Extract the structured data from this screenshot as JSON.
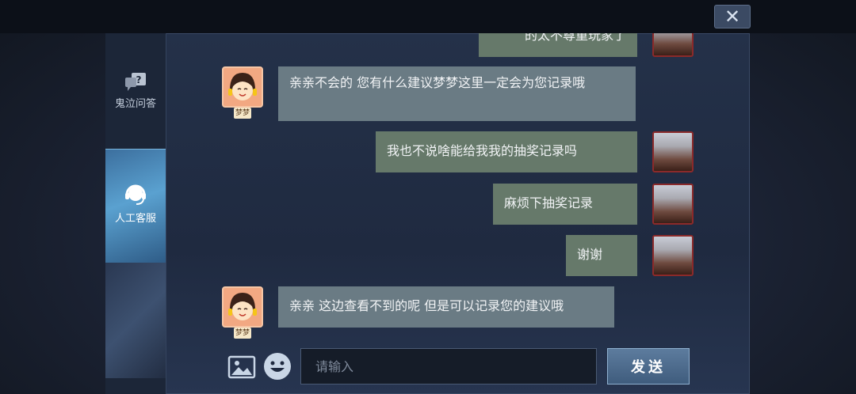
{
  "window": {
    "close_glyph": "✕"
  },
  "sidebar": {
    "items": [
      {
        "label": "鬼泣问答",
        "icon": "question-bubble-icon"
      },
      {
        "label": "人工客服",
        "icon": "headset-icon"
      }
    ]
  },
  "chat": {
    "messages": [
      {
        "from": "user",
        "text": "的太不尊重玩家了"
      },
      {
        "from": "agent",
        "name": "梦梦",
        "text": "亲亲不会的 您有什么建议梦梦这里一定会为您记录哦"
      },
      {
        "from": "user",
        "text": "我也不说啥能给我我的抽奖记录吗"
      },
      {
        "from": "user",
        "text": "麻烦下抽奖记录"
      },
      {
        "from": "user",
        "text": "谢谢"
      },
      {
        "from": "agent",
        "name": "梦梦",
        "text": "亲亲 这边查看不到的呢 但是可以记录您的建议哦"
      }
    ]
  },
  "input": {
    "placeholder": "请输入",
    "value": ""
  },
  "send": {
    "label": "发送"
  },
  "colors": {
    "agent_bubble": "#6a7b84",
    "user_bubble": "#66796a",
    "panel": "#1f2a40"
  }
}
